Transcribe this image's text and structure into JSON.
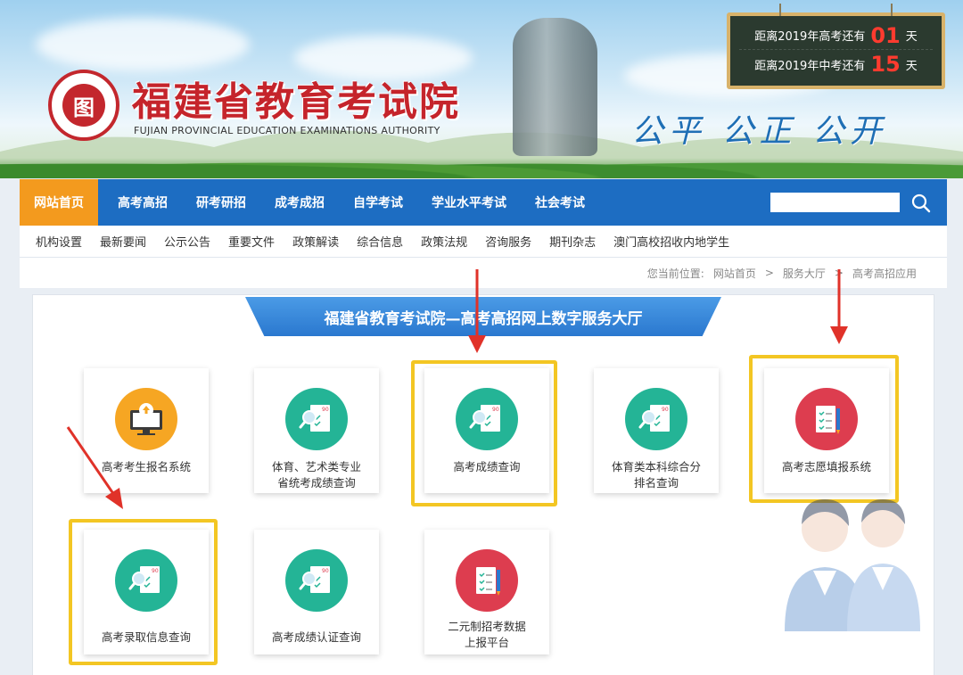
{
  "header": {
    "site_title": "福建省教育考试院",
    "site_subtitle": "FUJIAN PROVINCIAL EDUCATION EXAMINATIONS AUTHORITY",
    "slogan": "公平 公正 公开",
    "logo_char": "图"
  },
  "countdown": {
    "gaokao_prefix": "距离2019年高考还有",
    "gaokao_days": "01",
    "gaokao_suffix": "天",
    "zhongkao_prefix": "距离2019年中考还有",
    "zhongkao_days": "15",
    "zhongkao_suffix": "天"
  },
  "nav": {
    "items": [
      "网站首页",
      "高考高招",
      "研考研招",
      "成考成招",
      "自学考试",
      "学业水平考试",
      "社会考试"
    ],
    "search_placeholder": ""
  },
  "subnav": {
    "items": [
      "机构设置",
      "最新要闻",
      "公示公告",
      "重要文件",
      "政策解读",
      "综合信息",
      "政策法规",
      "咨询服务",
      "期刊杂志",
      "澳门高校招收内地学生"
    ]
  },
  "breadcrumb": {
    "prefix": "您当前位置:",
    "items": [
      "网站首页",
      ">",
      "服务大厅",
      ">",
      "高考高招应用"
    ]
  },
  "panel": {
    "title": "福建省教育考试院—高考高招网上数字服务大厅"
  },
  "services": [
    {
      "label": "高考考生报名系统",
      "icon": "upload-monitor-icon",
      "color": "orange"
    },
    {
      "label": "体育、艺术类专业\n省统考成绩查询",
      "icon": "score-search-icon",
      "color": "teal"
    },
    {
      "label": "高考成绩查询",
      "icon": "score-search-icon",
      "color": "teal"
    },
    {
      "label": "体育类本科综合分\n排名查询",
      "icon": "score-search-icon",
      "color": "teal"
    },
    {
      "label": "高考志愿填报系统",
      "icon": "form-pencil-icon",
      "color": "red"
    },
    {
      "label": "高考录取信息查询",
      "icon": "score-search-icon",
      "color": "teal"
    },
    {
      "label": "高考成绩认证查询",
      "icon": "score-search-icon",
      "color": "teal"
    },
    {
      "label": "二元制招考数据\n上报平台",
      "icon": "form-pencil-icon",
      "color": "red"
    }
  ]
}
